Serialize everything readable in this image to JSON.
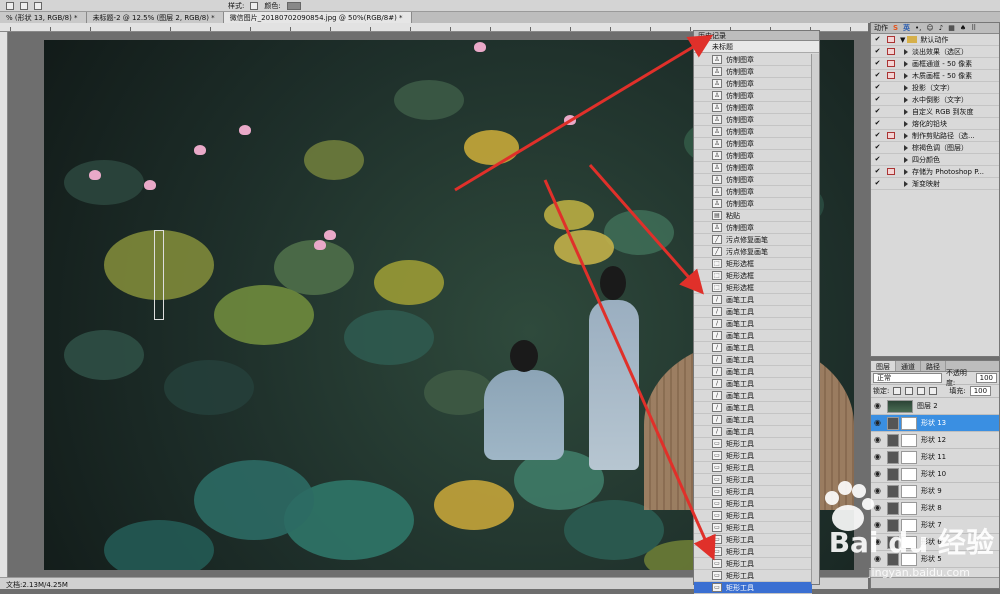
{
  "tabs": [
    {
      "label": "% (形状 13, RGB/8) *",
      "active": false
    },
    {
      "label": "未标题-2 @ 12.5% (图层 2, RGB/8) *",
      "active": false
    },
    {
      "label": "微信图片_20180702090854.jpg @ 50%(RGB/8#) *",
      "active": true
    }
  ],
  "toolbar": {
    "label": "样式:",
    "label2": "颜色:"
  },
  "status": {
    "text": "文档:2.13M/4.25M"
  },
  "history": {
    "title": "历史记录",
    "snapshot_label": "未标题",
    "items": [
      {
        "icon": "stamp-icon",
        "label": "仿制图章"
      },
      {
        "icon": "stamp-icon",
        "label": "仿制图章"
      },
      {
        "icon": "stamp-icon",
        "label": "仿制图章"
      },
      {
        "icon": "stamp-icon",
        "label": "仿制图章"
      },
      {
        "icon": "stamp-icon",
        "label": "仿制图章"
      },
      {
        "icon": "stamp-icon",
        "label": "仿制图章"
      },
      {
        "icon": "stamp-icon",
        "label": "仿制图章"
      },
      {
        "icon": "stamp-icon",
        "label": "仿制图章"
      },
      {
        "icon": "stamp-icon",
        "label": "仿制图章"
      },
      {
        "icon": "stamp-icon",
        "label": "仿制图章"
      },
      {
        "icon": "stamp-icon",
        "label": "仿制图章"
      },
      {
        "icon": "stamp-icon",
        "label": "仿制图章"
      },
      {
        "icon": "stamp-icon",
        "label": "仿制图章"
      },
      {
        "icon": "document-icon",
        "label": "粘贴"
      },
      {
        "icon": "stamp-icon",
        "label": "仿制图章"
      },
      {
        "icon": "healing-brush-icon",
        "label": "污点修复画笔"
      },
      {
        "icon": "healing-brush-icon",
        "label": "污点修复画笔"
      },
      {
        "icon": "marquee-icon",
        "label": "矩形选框"
      },
      {
        "icon": "marquee-icon",
        "label": "矩形选框"
      },
      {
        "icon": "marquee-icon",
        "label": "矩形选框"
      },
      {
        "icon": "brush-icon",
        "label": "画笔工具"
      },
      {
        "icon": "brush-icon",
        "label": "画笔工具"
      },
      {
        "icon": "brush-icon",
        "label": "画笔工具"
      },
      {
        "icon": "brush-icon",
        "label": "画笔工具"
      },
      {
        "icon": "brush-icon",
        "label": "画笔工具"
      },
      {
        "icon": "brush-icon",
        "label": "画笔工具"
      },
      {
        "icon": "brush-icon",
        "label": "画笔工具"
      },
      {
        "icon": "brush-icon",
        "label": "画笔工具"
      },
      {
        "icon": "brush-icon",
        "label": "画笔工具"
      },
      {
        "icon": "brush-icon",
        "label": "画笔工具"
      },
      {
        "icon": "brush-icon",
        "label": "画笔工具"
      },
      {
        "icon": "brush-icon",
        "label": "画笔工具"
      },
      {
        "icon": "shape-icon",
        "label": "矩形工具"
      },
      {
        "icon": "shape-icon",
        "label": "矩形工具"
      },
      {
        "icon": "shape-icon",
        "label": "矩形工具"
      },
      {
        "icon": "shape-icon",
        "label": "矩形工具"
      },
      {
        "icon": "shape-icon",
        "label": "矩形工具"
      },
      {
        "icon": "shape-icon",
        "label": "矩形工具"
      },
      {
        "icon": "shape-icon",
        "label": "矩形工具"
      },
      {
        "icon": "shape-icon",
        "label": "矩形工具"
      },
      {
        "icon": "shape-icon",
        "label": "矩形工具"
      },
      {
        "icon": "shape-icon",
        "label": "矩形工具"
      },
      {
        "icon": "shape-icon",
        "label": "矩形工具"
      },
      {
        "icon": "shape-icon",
        "label": "矩形工具"
      },
      {
        "icon": "shape-icon",
        "label": "矩形工具"
      }
    ]
  },
  "actions": {
    "tab": "动作",
    "set_name": "默认动作",
    "items": [
      {
        "label": "淡出效果（选区）",
        "dialog": true
      },
      {
        "label": "画框通道 - 50 像素",
        "dialog": true
      },
      {
        "label": "木质画框 - 50 像素",
        "dialog": true
      },
      {
        "label": "投影（文字）",
        "dialog": false
      },
      {
        "label": "水中倒影（文字）",
        "dialog": false
      },
      {
        "label": "自定义 RGB 到灰度",
        "dialog": false
      },
      {
        "label": "熔化的铅块",
        "dialog": false
      },
      {
        "label": "制作剪贴路径（选...",
        "dialog": true
      },
      {
        "label": "棕褐色调（图层）",
        "dialog": false
      },
      {
        "label": "四分颜色",
        "dialog": false
      },
      {
        "label": "存储为 Photoshop P...",
        "dialog": true
      },
      {
        "label": "渐变映射",
        "dialog": false
      }
    ]
  },
  "sogou": {
    "lang": "英"
  },
  "layers": {
    "tabs": [
      "图层",
      "通道",
      "路径"
    ],
    "blend_mode": "正常",
    "opacity_label": "不透明度:",
    "opacity_value": "100",
    "lock_label": "锁定:",
    "fill_label": "填充:",
    "fill_value": "100",
    "items": [
      {
        "name": "图层 2",
        "kind": "pixel",
        "selected": false
      },
      {
        "name": "形状 13",
        "kind": "shape",
        "selected": true
      },
      {
        "name": "形状 12",
        "kind": "shape",
        "selected": false
      },
      {
        "name": "形状 11",
        "kind": "shape",
        "selected": false
      },
      {
        "name": "形状 10",
        "kind": "shape",
        "selected": false
      },
      {
        "name": "形状 9",
        "kind": "shape",
        "selected": false
      },
      {
        "name": "形状 8",
        "kind": "shape",
        "selected": false
      },
      {
        "name": "形状 7",
        "kind": "shape",
        "selected": false
      },
      {
        "name": "形状 6",
        "kind": "shape",
        "selected": false
      },
      {
        "name": "形状 5",
        "kind": "shape",
        "selected": false
      }
    ]
  },
  "watermark": {
    "brand": "Bai du 经验",
    "url": "jingyan.baidu.com"
  },
  "colors": {
    "selection": "#3a6fd2",
    "arrow": "#e0302a"
  }
}
